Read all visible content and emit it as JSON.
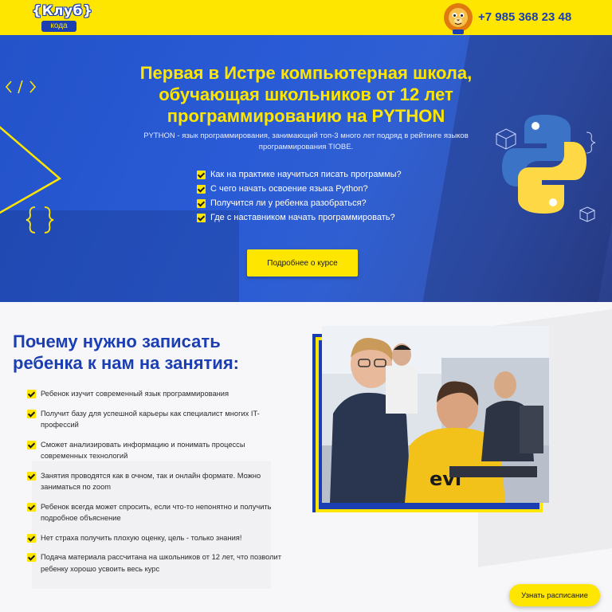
{
  "header": {
    "logo_top": "{Клуб}",
    "logo_bottom": "кода",
    "phone": "+7 985 368 23 48"
  },
  "hero": {
    "title_lines": [
      "Первая в Истре компьютерная школа,",
      "обучающая школьников от 12 лет",
      "программированию на PYTHON"
    ],
    "subtitle_lines": [
      "PYTHON - язык программирования, занимающий топ-3 много лет подряд в рейтинге языков",
      "программирования TIOBE."
    ],
    "checklist": [
      "Как на практике научиться писать программы?",
      "С чего начать освоение языка Python?",
      "Получится ли у ребенка разобраться?",
      "Где с наставником начать программировать?"
    ],
    "button_label": "Подробнее о курсе"
  },
  "why": {
    "title_lines": [
      "Почему нужно записать",
      "ребенка к нам на занятия:"
    ],
    "reasons": [
      [
        "Ребенок изучит современный язык программирования"
      ],
      [
        "Получит базу для успешной карьеры как специалист многих IT-",
        "профессий"
      ],
      [
        "Сможет анализировать информацию и понимать процессы",
        "современных технологий"
      ],
      [
        "Занятия проводятся как в очном, так и онлайн формате. Можно",
        "заниматься по zoom"
      ],
      [
        "Ребенок всегда может спросить, если что-то непонятно и получить",
        "подробное объяснение"
      ],
      [
        "Нет страха получить плохую оценку, цель - только знания!"
      ],
      [
        "Подача материала рассчитана на школьников от 12 лет, что позволит",
        "ребенку хорошо усвоить весь курс"
      ]
    ]
  },
  "floating": {
    "schedule_label": "Узнать расписание"
  },
  "colors": {
    "yellow": "#ffe600",
    "blue": "#1b3fb3",
    "hero_blue": "#2a5bd6"
  },
  "icons": [
    "lion-mascot-icon",
    "python-logo-icon",
    "code-brackets-icon",
    "checkbox-icon"
  ]
}
